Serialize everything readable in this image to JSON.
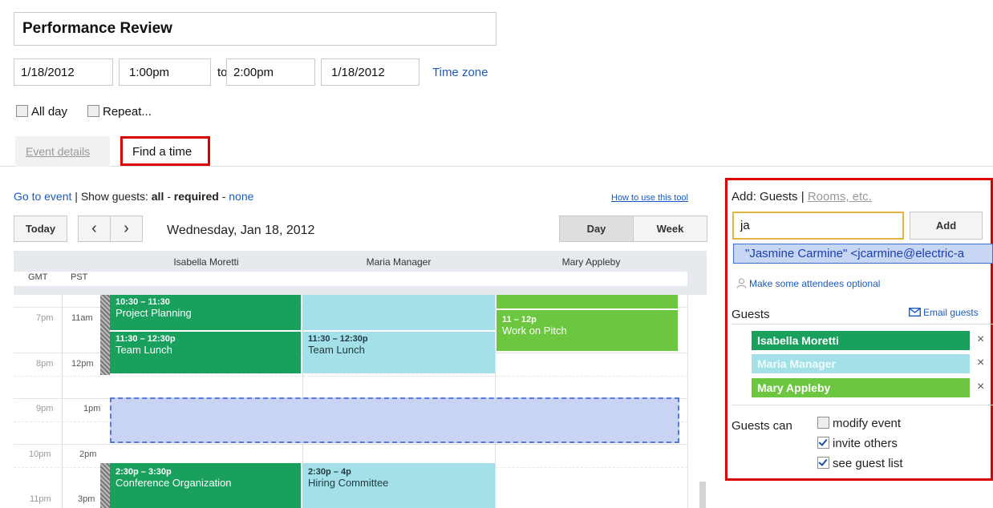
{
  "event": {
    "title": "Performance Review",
    "start_date": "1/18/2012",
    "start_time": "1:00pm",
    "to_label": "to",
    "end_time": "2:00pm",
    "end_date": "1/18/2012",
    "time_zone_link": "Time zone",
    "all_day_label": "All day",
    "repeat_label": "Repeat..."
  },
  "tabs": [
    {
      "label": "Event details",
      "active": false
    },
    {
      "label": "Find a time",
      "active": true
    }
  ],
  "find_time": {
    "go_to_event": "Go to event",
    "sep": " | ",
    "show_guests": "Show guests:",
    "all": "all",
    "dash1": " - ",
    "required": "required",
    "dash2": " - ",
    "none": "none",
    "how_to": "How to use this tool",
    "today_btn": "Today",
    "prev_icon": "chevron-left-icon",
    "next_icon": "chevron-right-icon",
    "prev_glyph": "‹",
    "next_glyph": "›",
    "date": "Wednesday, Jan 18, 2012",
    "day_btn": "Day",
    "week_btn": "Week",
    "tz1": "GMT",
    "tz2": "PST",
    "columns": [
      "Isabella Moretti",
      "Maria Manager",
      "Mary Appleby"
    ],
    "rows": [
      {
        "gmt": "7pm",
        "pst": "11am"
      },
      {
        "gmt": "8pm",
        "pst": "12pm"
      },
      {
        "gmt": "9pm",
        "pst": "1pm"
      },
      {
        "gmt": "10pm",
        "pst": "2pm"
      },
      {
        "gmt": "11pm",
        "pst": "3pm"
      }
    ],
    "events": [
      {
        "time": "10:30 – 11:30",
        "title": "Project Planning",
        "color": "dark"
      },
      {
        "time": "11:30 – 12:30p",
        "title": "Team Lunch",
        "color": "dark"
      },
      {
        "time": "11:30 – 12:30p",
        "title": "Team Lunch",
        "color": "light"
      },
      {
        "time": "11 – 12p",
        "title": "Work on Pitch",
        "color": "lime"
      },
      {
        "time": "2:30p – 3:30p",
        "title": "Conference Organization",
        "color": "dark"
      },
      {
        "time": "2:30p – 4p",
        "title": "Hiring Committee",
        "color": "light"
      }
    ]
  },
  "guest_panel": {
    "add_label": "Add:",
    "guests_tab": "Guests",
    "sep": "|",
    "rooms_tab": "Rooms, etc.",
    "input_value": "ja",
    "add_btn": "Add",
    "suggestion": "\"Jasmine Carmine\" <jcarmine@electric-a",
    "optional_link": "Make some attendees optional",
    "guests_heading": "Guests",
    "email_link": "Email guests",
    "guests": [
      {
        "name": "Isabella Moretti",
        "color": "dark"
      },
      {
        "name": "Maria Manager",
        "color": "light"
      },
      {
        "name": "Mary Appleby",
        "color": "lime"
      }
    ],
    "remove_glyph": "×",
    "guests_can": "Guests can",
    "permissions": [
      {
        "label": "modify event",
        "checked": false
      },
      {
        "label": "invite others",
        "checked": true
      },
      {
        "label": "see guest list",
        "checked": true
      }
    ]
  },
  "colors": {
    "dark_green": "#18a05c",
    "light_cyan": "#a4e0e8",
    "lime": "#6cc640",
    "highlight_red": "#dd0000",
    "selection": "#c9d3f3",
    "link": "#1a5bbf"
  }
}
